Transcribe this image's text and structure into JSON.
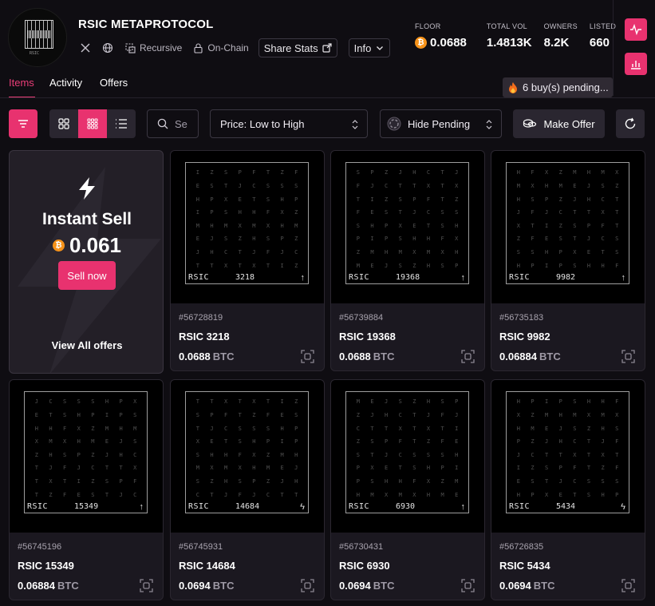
{
  "collection": {
    "name": "RSIC METAPROTOCOL",
    "logo_text": "RSIC",
    "tags": [
      "Recursive",
      "On-Chain"
    ],
    "share_stats_label": "Share Stats",
    "info_label": "Info"
  },
  "stats": [
    {
      "label": "FLOOR",
      "value": "0.0688",
      "btc": true
    },
    {
      "label": "TOTAL VOL",
      "value": "1.4813K",
      "btc": false
    },
    {
      "label": "OWNERS",
      "value": "8.2K",
      "btc": false
    },
    {
      "label": "LISTED",
      "value": "660",
      "btc": false
    }
  ],
  "tabs": [
    "Items",
    "Activity",
    "Offers"
  ],
  "pending_notice": "6 buy(s) pending...",
  "toolbar": {
    "search_placeholder": "Se",
    "sort_label": "Price: Low to High",
    "hide_pending_label": "Hide Pending",
    "make_offer_label": "Make Offer"
  },
  "instant_sell": {
    "title": "Instant Sell",
    "price": "0.061",
    "sell_label": "Sell now",
    "view_all_label": "View All offers"
  },
  "cards": [
    {
      "id": "#56728819",
      "name": "RSIC 3218",
      "art_number": "3218",
      "price": "0.0688",
      "unit": "BTC",
      "symbol": "↑"
    },
    {
      "id": "#56739884",
      "name": "RSIC 19368",
      "art_number": "19368",
      "price": "0.0688",
      "unit": "BTC",
      "symbol": "↑"
    },
    {
      "id": "#56735183",
      "name": "RSIC 9982",
      "art_number": "9982",
      "price": "0.06884",
      "unit": "BTC",
      "symbol": "↑"
    },
    {
      "id": "#56745196",
      "name": "RSIC 15349",
      "art_number": "15349",
      "price": "0.06884",
      "unit": "BTC",
      "symbol": "↑"
    },
    {
      "id": "#56745931",
      "name": "RSIC 14684",
      "art_number": "14684",
      "price": "0.0694",
      "unit": "BTC",
      "symbol": "ϟ"
    },
    {
      "id": "#56730431",
      "name": "RSIC 6930",
      "art_number": "6930",
      "price": "0.0694",
      "unit": "BTC",
      "symbol": "↑"
    },
    {
      "id": "#56726835",
      "name": "RSIC 5434",
      "art_number": "5434",
      "price": "0.0694",
      "unit": "BTC",
      "symbol": "ϟ"
    }
  ],
  "art_label": "RSIC",
  "colors": {
    "accent": "#e8326f",
    "background": "#0f0d12",
    "card": "#1b1820",
    "btc": "#f7931a"
  }
}
